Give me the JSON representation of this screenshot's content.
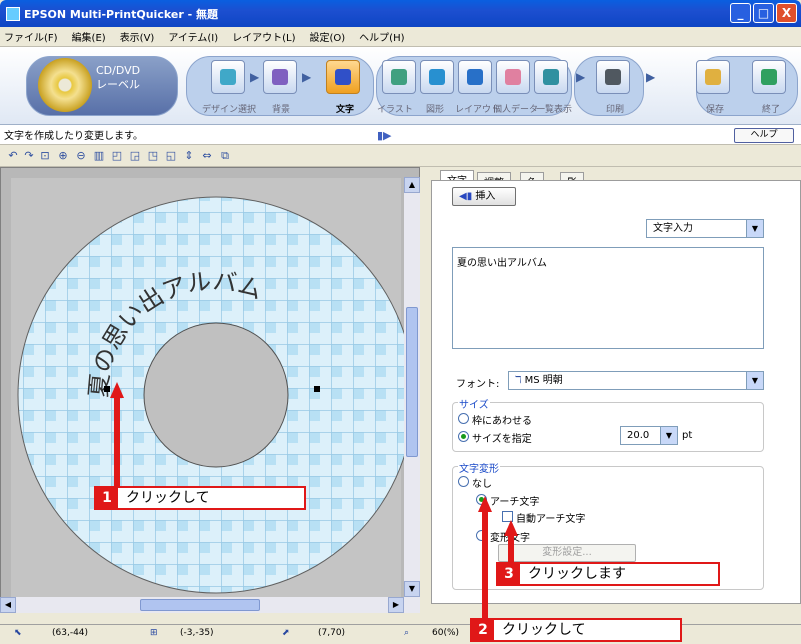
{
  "window": {
    "title": "EPSON Multi-PrintQuicker - 無題",
    "minimize": "_",
    "maximize": "□",
    "close": "X"
  },
  "menu": [
    "ファイル(F)",
    "編集(E)",
    "表示(V)",
    "アイテム(I)",
    "レイアウト(L)",
    "設定(O)",
    "ヘルプ(H)"
  ],
  "toolbar": {
    "mode_label_line1": "CD/DVD",
    "mode_label_line2": "レーベル",
    "buttons": [
      {
        "label": "デザイン選択",
        "icon": "design-select-icon"
      },
      {
        "label": "背景",
        "icon": "background-icon"
      },
      {
        "label": "文字",
        "icon": "text-icon",
        "active": true
      },
      {
        "label": "イラスト",
        "icon": "illustration-icon"
      },
      {
        "label": "図形",
        "icon": "shape-icon"
      },
      {
        "label": "レイアウト",
        "icon": "layout-icon"
      },
      {
        "label": "個人データ",
        "icon": "personal-data-icon"
      },
      {
        "label": "一覧表示",
        "icon": "list-view-icon"
      },
      {
        "label": "印刷",
        "icon": "print-icon"
      },
      {
        "label": "保存",
        "icon": "save-icon"
      },
      {
        "label": "終了",
        "icon": "exit-icon"
      }
    ]
  },
  "status_line": {
    "text": "文字を作成したり変更します。",
    "help": "ヘルプ"
  },
  "canvas": {
    "arc_text": "夏の思い出アルバム"
  },
  "panel": {
    "tabs": [
      "文字",
      "調整",
      "色",
      "影"
    ],
    "insert_label": "挿入",
    "input_mode": "文字入力",
    "text_value": "夏の思い出アルバム",
    "font_label": "フォント:",
    "font_value": "MS 明朝",
    "size_group": "サイズ",
    "size_options": [
      "枠にあわせる",
      "サイズを指定"
    ],
    "size_value": "20.0",
    "size_unit": "pt",
    "shape_group": "文字変形",
    "shape_options": [
      "なし",
      "アーチ文字",
      "変形文字"
    ],
    "auto_arch": "自動アーチ文字",
    "shape_settings": "変形設定..."
  },
  "statusbar": {
    "pos1": "(63,-44)",
    "pos2": "(-3,-35)",
    "pos3": "(7,70)",
    "zoom": "60(%)"
  },
  "callouts": [
    {
      "num": "1",
      "text": "クリックして"
    },
    {
      "num": "2",
      "text": "クリックして"
    },
    {
      "num": "3",
      "text": "クリックします"
    }
  ]
}
